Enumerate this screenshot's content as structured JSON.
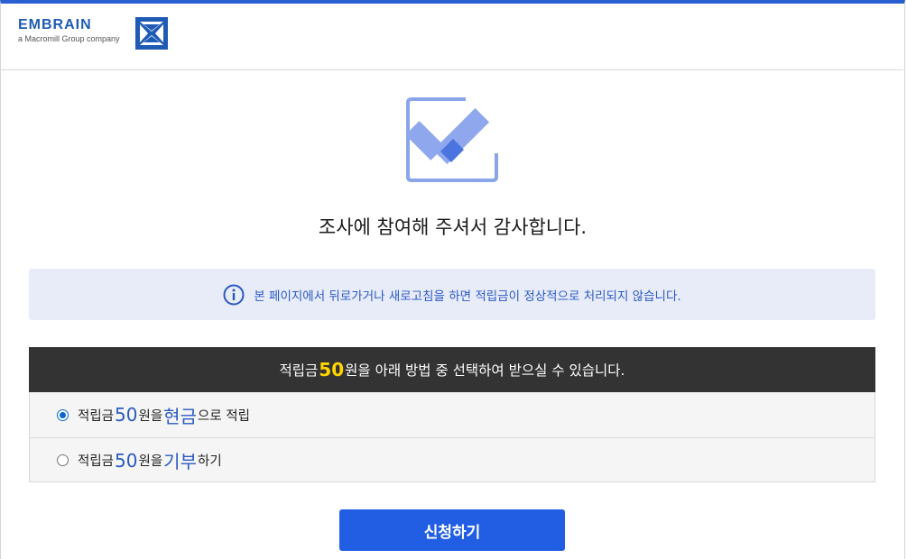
{
  "brand": {
    "name": "EMBRAIN",
    "tagline": "a Macromill Group company",
    "color": "#1f5bb5"
  },
  "icons": {
    "logo": "macromill-x-logo-icon",
    "complete": "checkbox-checked-icon",
    "info": "info-icon"
  },
  "thanks_message": "조사에 참여해 주셔서 감사합니다.",
  "notice": {
    "text": "본 페이지에서 뒤로가거나 새로고침을 하면 적립금이 정상적으로 처리되지 않습니다."
  },
  "reward": {
    "header_prefix": "적립금 ",
    "header_amount": "50",
    "header_suffix": "원을 아래 방법 중 선택하여 받으실 수 있습니다.",
    "options": [
      {
        "prefix": "적립금 ",
        "amount": "50",
        "mid": "원을 ",
        "method": "현금",
        "suffix": "으로 적립",
        "selected": true
      },
      {
        "prefix": "적립금 ",
        "amount": "50",
        "mid": "원을 ",
        "method": "기부",
        "suffix": "하기",
        "selected": false
      }
    ]
  },
  "submit_label": "신청하기",
  "colors": {
    "accent": "#225ee3",
    "header_bar": "#333333",
    "amount_highlight": "#ffd600",
    "notice_bg": "#e8ecf8"
  }
}
